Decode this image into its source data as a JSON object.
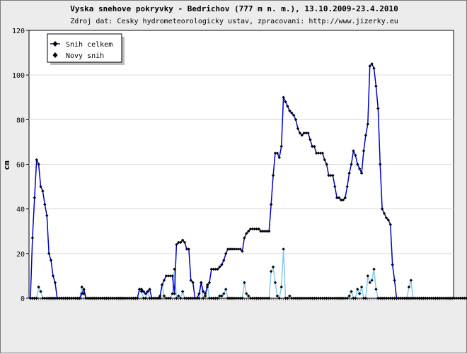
{
  "chart_data": {
    "type": "line",
    "title": "Vyska snehove pokryvky - Bedrichov (777 m n. m.), 13.10.2009-23.4.2010",
    "subtitle": "Zdroj dat: Cesky hydrometeorologicky ustav, zpracovani: http://www.jizerky.eu",
    "ylabel": "cm",
    "xlabel": "",
    "ylim": [
      0,
      120
    ],
    "yticks": [
      0,
      20,
      40,
      60,
      80,
      100,
      120
    ],
    "grid": true,
    "legend_position": "top-left",
    "series": [
      {
        "name": "Snih celkem",
        "color": "#0000cc",
        "values": [
          0,
          27,
          45,
          62,
          60,
          50,
          48,
          42,
          37,
          20,
          17,
          10,
          7,
          0,
          0,
          0,
          0,
          0,
          0,
          0,
          0,
          0,
          0,
          0,
          0,
          2,
          4,
          0,
          0,
          0,
          0,
          0,
          0,
          0,
          0,
          0,
          0,
          0,
          0,
          0,
          0,
          0,
          0,
          0,
          0,
          0,
          0,
          0,
          0,
          0,
          0,
          0,
          0,
          4,
          4,
          3,
          2,
          3,
          4,
          0,
          0,
          0,
          0,
          1,
          6,
          8,
          10,
          10,
          10,
          10,
          2,
          24,
          25,
          25,
          26,
          25,
          22,
          22,
          8,
          7,
          0,
          0,
          2,
          7,
          3,
          2,
          5,
          7,
          13,
          13,
          13,
          13,
          14,
          15,
          17,
          20,
          22,
          22,
          22,
          22,
          22,
          22,
          22,
          21,
          27,
          29,
          30,
          31,
          31,
          31,
          31,
          31,
          30,
          30,
          30,
          30,
          30,
          42,
          55,
          65,
          65,
          63,
          68,
          90,
          88,
          86,
          84,
          83,
          82,
          80,
          76,
          74,
          73,
          74,
          74,
          74,
          71,
          68,
          68,
          65,
          65,
          65,
          65,
          62,
          60,
          55,
          55,
          55,
          50,
          45,
          45,
          44,
          44,
          45,
          50,
          56,
          60,
          66,
          64,
          60,
          58,
          56,
          66,
          73,
          78,
          104,
          105,
          103,
          95,
          85,
          60,
          40,
          38,
          36,
          35,
          33,
          15,
          8,
          0,
          0,
          0,
          0,
          0,
          0,
          0,
          0,
          0,
          0,
          0,
          0,
          0,
          0,
          0,
          0,
          0,
          0,
          0,
          0,
          0,
          0,
          0,
          0,
          0,
          0,
          0,
          0
        ]
      },
      {
        "name": "Novy snih",
        "color": "#88c8ee",
        "values": [
          0,
          0,
          0,
          0,
          5,
          3,
          0,
          0,
          0,
          0,
          0,
          0,
          0,
          0,
          0,
          0,
          0,
          0,
          0,
          0,
          0,
          0,
          0,
          0,
          0,
          5,
          2,
          0,
          0,
          0,
          0,
          0,
          0,
          0,
          0,
          0,
          0,
          0,
          0,
          0,
          0,
          0,
          0,
          0,
          0,
          0,
          0,
          0,
          0,
          0,
          0,
          0,
          0,
          4,
          3,
          0,
          0,
          3,
          0,
          0,
          0,
          0,
          0,
          0,
          6,
          1,
          0,
          0,
          0,
          2,
          13,
          0,
          1,
          0,
          3,
          0,
          0,
          0,
          0,
          0,
          0,
          0,
          0,
          7,
          0,
          1,
          6,
          0,
          0,
          0,
          0,
          0,
          1,
          1,
          2,
          4,
          0,
          0,
          0,
          0,
          0,
          0,
          0,
          0,
          7,
          2,
          1,
          0,
          0,
          0,
          0,
          0,
          0,
          0,
          0,
          0,
          0,
          12,
          14,
          7,
          1,
          0,
          5,
          22,
          0,
          0,
          1,
          0,
          0,
          0,
          0,
          0,
          0,
          0,
          0,
          0,
          0,
          0,
          0,
          0,
          0,
          0,
          0,
          0,
          0,
          0,
          0,
          0,
          0,
          0,
          0,
          0,
          0,
          0,
          0,
          1,
          3,
          0,
          0,
          4,
          2,
          5,
          0,
          0,
          10,
          7,
          8,
          13,
          4,
          0,
          0,
          0,
          0,
          0,
          0,
          0,
          0,
          0,
          0,
          0,
          0,
          0,
          0,
          0,
          5,
          8,
          0,
          0,
          0,
          0,
          0,
          0,
          0,
          0,
          0,
          0,
          0,
          0,
          0,
          0,
          0,
          0,
          0,
          0,
          0,
          0,
          0,
          0,
          0,
          0,
          0,
          0,
          0,
          0,
          0,
          0,
          0,
          0,
          0
        ]
      }
    ]
  }
}
